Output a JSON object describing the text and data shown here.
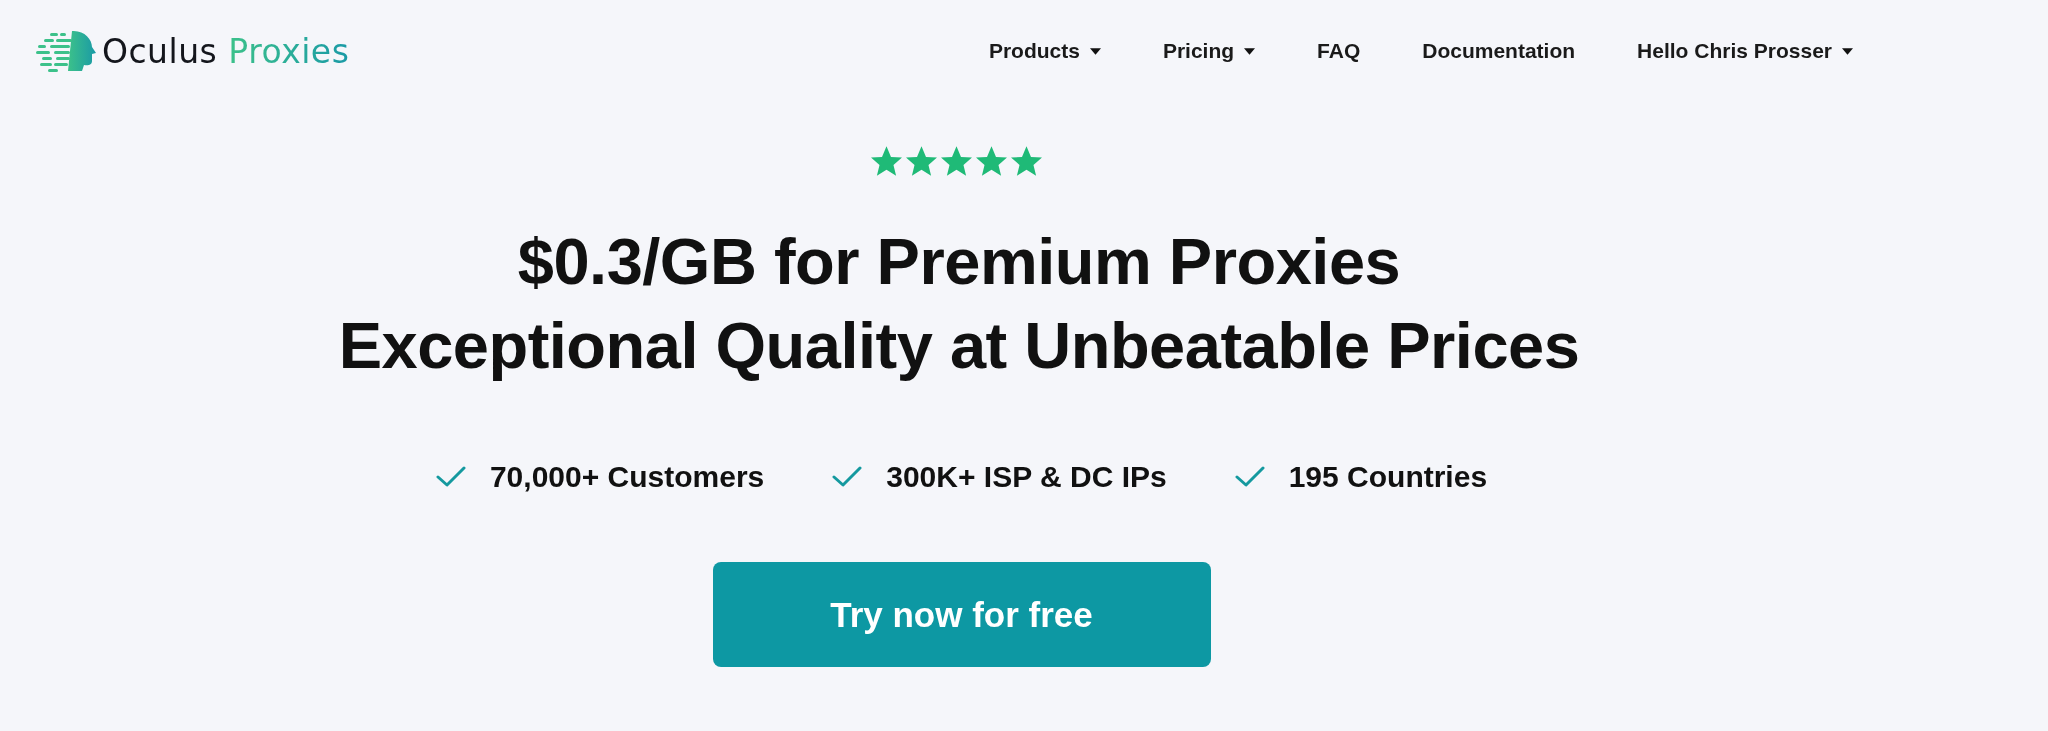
{
  "logo": {
    "word_1": "Oculus",
    "word_2": "Proxies"
  },
  "nav": [
    {
      "label": "Products",
      "dropdown": true
    },
    {
      "label": "Pricing",
      "dropdown": true
    },
    {
      "label": "FAQ",
      "dropdown": false
    },
    {
      "label": "Documentation",
      "dropdown": false
    },
    {
      "label": "Hello Chris Prosser",
      "dropdown": true
    }
  ],
  "hero": {
    "stars": 5,
    "headline": [
      "$0.3/GB for Premium Proxies",
      "Exceptional Quality at Unbeatable Prices"
    ],
    "features": [
      "70,000+ Customers",
      "300K+ ISP & DC IPs",
      "195 Countries"
    ],
    "cta": "Try now for free"
  }
}
